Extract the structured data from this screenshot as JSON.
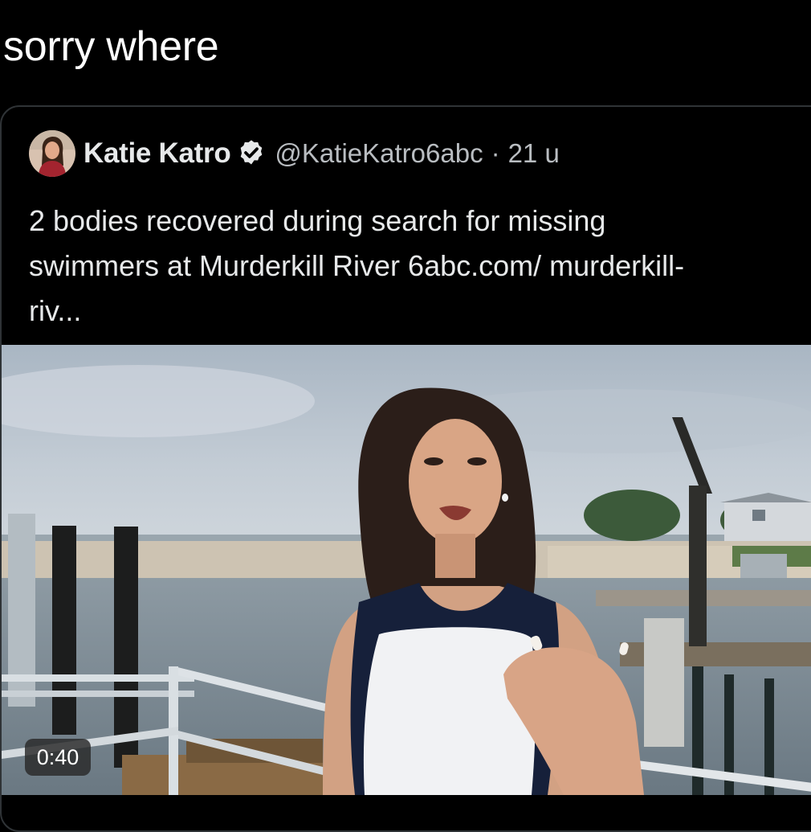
{
  "post": {
    "caption": "sorry where"
  },
  "quoted_tweet": {
    "author": {
      "display_name": "Katie Katro",
      "handle": "@KatieKatro6abc",
      "separator": "·",
      "time": "21 u",
      "avatar_icon": "avatar-photo",
      "verified_icon": "verified-badge-icon"
    },
    "text": "2 bodies recovered during search for missing swimmers at Murderkill River 6abc.com/ murderkill-riv...",
    "video": {
      "duration": "0:40"
    }
  },
  "colors": {
    "background": "#000000",
    "card_border": "#2f3336",
    "primary_text": "#e7e9ea",
    "secondary_text": "#b9bdc1"
  }
}
